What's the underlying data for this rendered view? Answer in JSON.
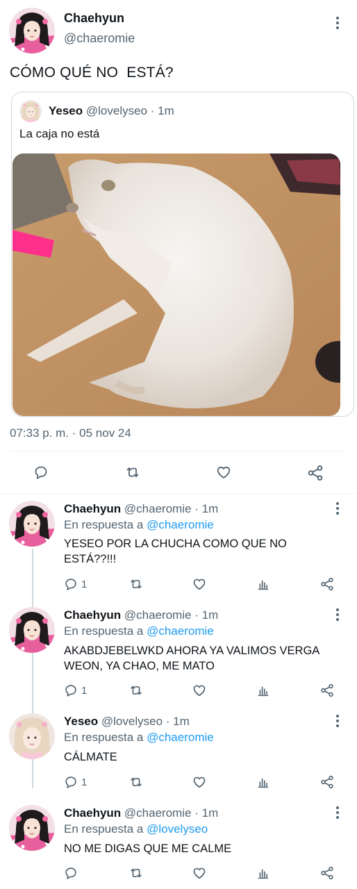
{
  "main_tweet": {
    "author_name": "Chaehyun",
    "author_handle": "@chaeromie",
    "text": "CÓMO QUÉ NO  ESTÁ?",
    "timestamp": "07:33 p. m. · 05 nov 24",
    "quoted": {
      "author_name": "Yeseo",
      "author_handle": "@lovelyseo",
      "time": "· 1m",
      "text": "La caja no está"
    }
  },
  "replies": [
    {
      "author_name": "Chaehyun",
      "author_handle": "@chaeromie",
      "time": "· 1m",
      "reply_prefix": "En respuesta a",
      "reply_to": "@chaeromie",
      "text": "YESEO POR LA CHUCHA COMO QUE NO ESTÁ??!!!",
      "reply_count": "1"
    },
    {
      "author_name": "Chaehyun",
      "author_handle": "@chaeromie",
      "time": "· 1m",
      "reply_prefix": "En respuesta a",
      "reply_to": "@chaeromie",
      "text": "AKABDJEBELWKD AHORA YA VALIMOS VERGA WEON, YA CHAO, ME MATO",
      "reply_count": "1"
    },
    {
      "author_name": "Yeseo",
      "author_handle": "@lovelyseo",
      "time": "· 1m",
      "reply_prefix": "En respuesta a",
      "reply_to": "@chaeromie",
      "text": "CÁLMATE",
      "reply_count": "1"
    },
    {
      "author_name": "Chaehyun",
      "author_handle": "@chaeromie",
      "time": "· 1m",
      "reply_prefix": "En respuesta a",
      "reply_to": "@lovelyseo",
      "text": "NO ME DIGAS QUE ME CALME",
      "reply_count": ""
    }
  ],
  "icons": {
    "reply": "reply-icon",
    "retweet": "retweet-icon",
    "like": "heart-icon",
    "stats": "analytics-icon",
    "share": "share-icon",
    "more": "more-vertical-icon"
  },
  "colors": {
    "text": "#0f1419",
    "secondary": "#536471",
    "link": "#1d9bf0",
    "border": "#cfd9de"
  }
}
